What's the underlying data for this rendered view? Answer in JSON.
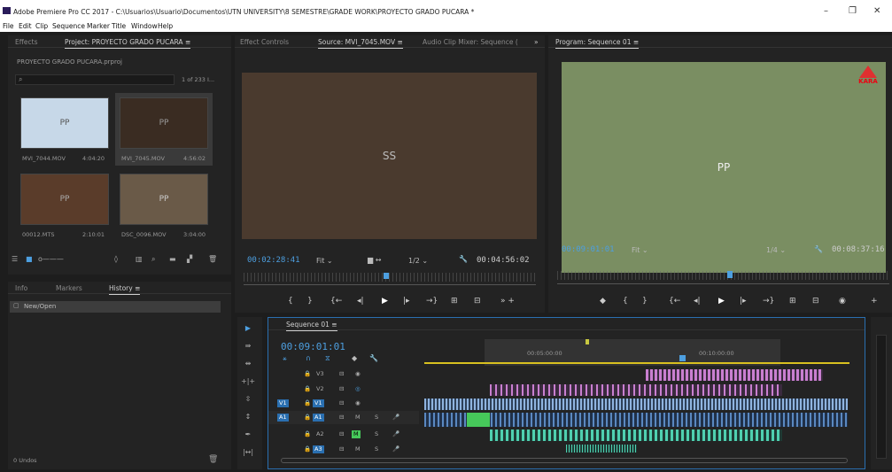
{
  "app": {
    "title": "Adobe Premiere Pro CC 2017 - C:\\Usuarios\\Usuario\\Documentos\\UTN UNIVERSITY\\8 SEMESTRE\\GRADE WORK\\PROYECTO GRADO PUCARA *",
    "min": "–",
    "max": "❐",
    "close": "✕"
  },
  "menu": [
    "File",
    "Edit",
    "Clip",
    "Sequence",
    "Marker",
    "Title",
    "Window",
    "Help"
  ],
  "project": {
    "tab_effects": "Effects",
    "tab_project": "Project: PROYECTO GRADO PUCARA ≡",
    "file": "PROYECTO GRADO PUCARA.prproj",
    "count": "1 of 233 I...",
    "items": [
      {
        "name": "MVI_7044.MOV",
        "dur": "4:04:20"
      },
      {
        "name": "MVI_7045.MOV",
        "dur": "4:56:02"
      },
      {
        "name": "00012.MTS",
        "dur": "2:10:01"
      },
      {
        "name": "DSC_0096.MOV",
        "dur": "3:04:00"
      }
    ]
  },
  "history": {
    "tab_info": "Info",
    "tab_markers": "Markers",
    "tab_history": "History ≡",
    "entry": "New/Open",
    "undos": "0 Undos"
  },
  "source": {
    "tab_effect_controls": "Effect Controls",
    "tab_source": "Source: MVI_7045.MOV ≡",
    "tab_mixer": "Audio Clip Mixer: Sequence (",
    "more": "»",
    "tc_in": "00:02:28:41",
    "fit": "Fit",
    "res": "1/2",
    "tc_dur": "00:04:56:02"
  },
  "program": {
    "tab": "Program: Sequence 01 ≡",
    "tc_in": "00:09:01:01",
    "fit": "Fit",
    "res": "1/4",
    "tc_dur": "00:08:37:16",
    "logo": "KARA"
  },
  "timeline": {
    "tab": "Sequence 01 ≡",
    "timecode": "00:09:01:01",
    "t1": "00:05:00:00",
    "t2": "00:10:00:00",
    "tracks": [
      {
        "name": "V3"
      },
      {
        "name": "V2"
      },
      {
        "name": "V1",
        "src": "V1"
      },
      {
        "name": "A1",
        "src": "A1",
        "m": "M",
        "s": "S"
      },
      {
        "name": "A2",
        "m": "M",
        "s": "S"
      },
      {
        "name": "A3",
        "m": "M",
        "s": "S"
      }
    ]
  },
  "colors": {
    "accent": "#4d9fe0",
    "video_clip": "#c97fd0",
    "audio_clip": "#4fd0b0",
    "audio_green": "#46c85a"
  }
}
